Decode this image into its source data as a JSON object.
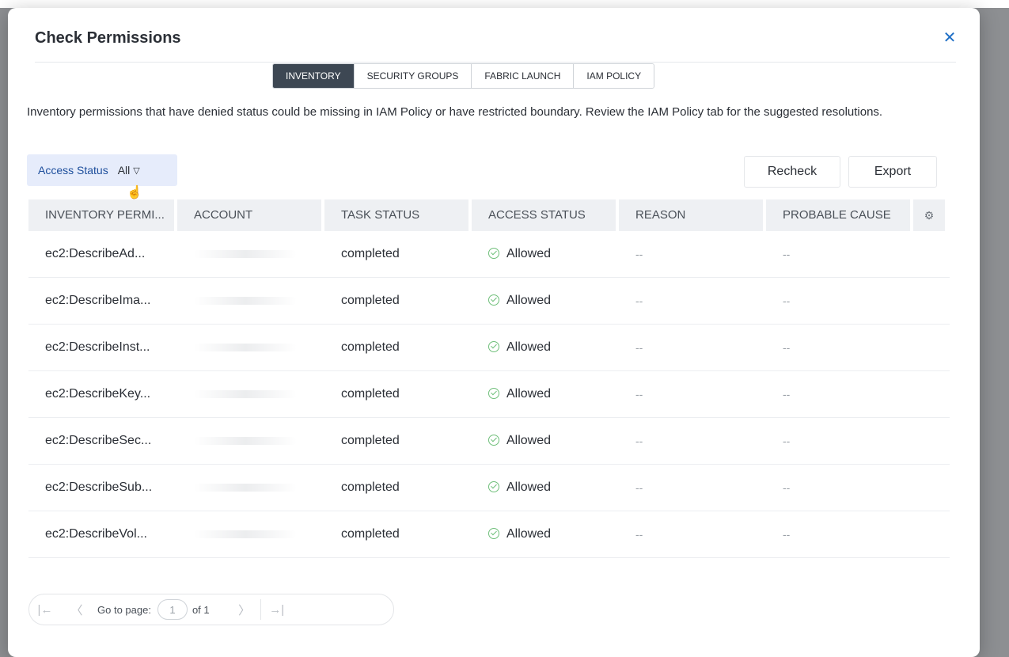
{
  "modal": {
    "title": "Check Permissions",
    "close_icon": "close-icon"
  },
  "tabs": [
    {
      "label": "INVENTORY",
      "active": true
    },
    {
      "label": "SECURITY GROUPS",
      "active": false
    },
    {
      "label": "FABRIC LAUNCH",
      "active": false
    },
    {
      "label": "IAM POLICY",
      "active": false
    }
  ],
  "description": "Inventory permissions that have denied status could be missing in IAM Policy or have restricted boundary. Review the IAM Policy tab for the suggested resolutions.",
  "filter": {
    "label": "Access Status",
    "value": "All",
    "caret_icon": "caret-down-icon"
  },
  "actions": {
    "recheck": "Recheck",
    "export": "Export"
  },
  "table": {
    "columns": [
      "INVENTORY PERMI...",
      "ACCOUNT",
      "TASK STATUS",
      "ACCESS STATUS",
      "REASON",
      "PROBABLE CAUSE"
    ],
    "settings_icon": "gear-icon",
    "rows": [
      {
        "permission": "ec2:DescribeAd...",
        "account": "",
        "task_status": "completed",
        "access_status": "Allowed",
        "reason": "--",
        "cause": "--"
      },
      {
        "permission": "ec2:DescribeIma...",
        "account": "",
        "task_status": "completed",
        "access_status": "Allowed",
        "reason": "--",
        "cause": "--"
      },
      {
        "permission": "ec2:DescribeInst...",
        "account": "",
        "task_status": "completed",
        "access_status": "Allowed",
        "reason": "--",
        "cause": "--"
      },
      {
        "permission": "ec2:DescribeKey...",
        "account": "",
        "task_status": "completed",
        "access_status": "Allowed",
        "reason": "--",
        "cause": "--"
      },
      {
        "permission": "ec2:DescribeSec...",
        "account": "",
        "task_status": "completed",
        "access_status": "Allowed",
        "reason": "--",
        "cause": "--"
      },
      {
        "permission": "ec2:DescribeSub...",
        "account": "",
        "task_status": "completed",
        "access_status": "Allowed",
        "reason": "--",
        "cause": "--"
      },
      {
        "permission": "ec2:DescribeVol...",
        "account": "",
        "task_status": "completed",
        "access_status": "Allowed",
        "reason": "--",
        "cause": "--"
      }
    ]
  },
  "pagination": {
    "go_to_label": "Go to page:",
    "page_value": "1",
    "of_label": "of 1",
    "first_icon": "first-page-icon",
    "prev_icon": "prev-page-icon",
    "next_icon": "next-page-icon",
    "last_icon": "last-page-icon"
  },
  "colors": {
    "accent": "#1f6fc6",
    "active_tab": "#3d4753",
    "filter_bg": "#e6ecfb",
    "allowed": "#6fbf7a"
  }
}
